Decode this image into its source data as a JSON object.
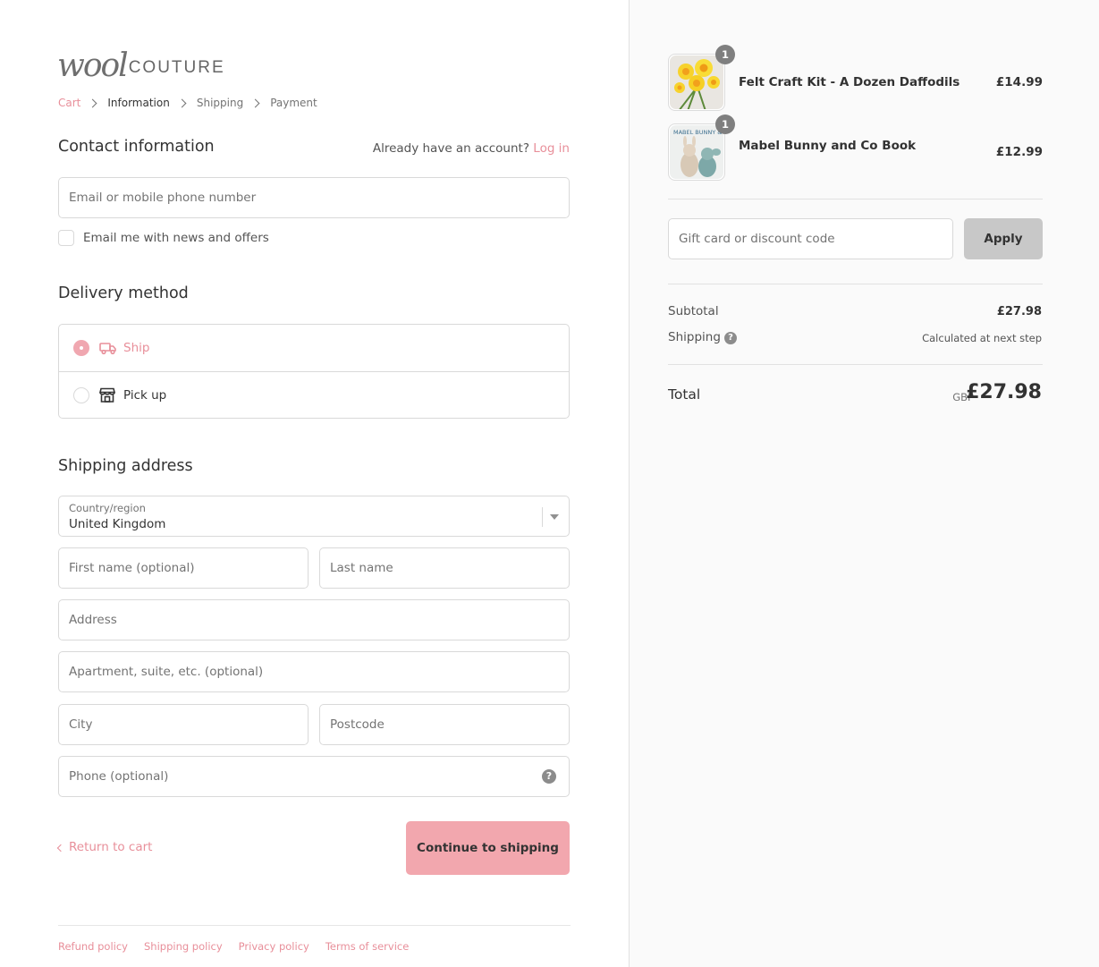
{
  "logo": {
    "script": "wool",
    "caps": "COUTURE"
  },
  "breadcrumb": [
    "Cart",
    "Information",
    "Shipping",
    "Payment"
  ],
  "contact": {
    "title": "Contact information",
    "account_prompt": "Already have an account?",
    "login": "Log in",
    "email_placeholder": "Email or mobile phone number",
    "newsletter_label": "Email me with news and offers"
  },
  "delivery": {
    "title": "Delivery method",
    "options": [
      {
        "label": "Ship",
        "icon": "truck-icon",
        "selected": true
      },
      {
        "label": "Pick up",
        "icon": "store-icon",
        "selected": false
      }
    ]
  },
  "shipping": {
    "title": "Shipping address",
    "country_label": "Country/region",
    "country_value": "United Kingdom",
    "first_name": "First name (optional)",
    "last_name": "Last name",
    "address": "Address",
    "apartment": "Apartment, suite, etc. (optional)",
    "city": "City",
    "postcode": "Postcode",
    "phone": "Phone (optional)"
  },
  "actions": {
    "return": "Return to cart",
    "continue": "Continue to shipping"
  },
  "footer": [
    "Refund policy",
    "Shipping policy",
    "Privacy policy",
    "Terms of service"
  ],
  "cart": {
    "items": [
      {
        "name": "Felt Craft Kit - A Dozen Daffodils",
        "price": "£14.99",
        "qty": "1"
      },
      {
        "name": "Mabel Bunny and Co Book",
        "price": "£12.99",
        "qty": "1",
        "cover_text": "MABEL BUNNY & CO"
      }
    ],
    "discount_placeholder": "Gift card or discount code",
    "apply": "Apply",
    "subtotal_label": "Subtotal",
    "subtotal": "£27.98",
    "shipping_label": "Shipping",
    "shipping_note": "Calculated at next step",
    "total_label": "Total",
    "currency": "GBP",
    "total": "£27.98"
  },
  "colors": {
    "accent": "#e88f9a",
    "button": "#f2a7ae",
    "apply_button": "#c8c8c8",
    "sidebar_bg": "#fafafa"
  }
}
